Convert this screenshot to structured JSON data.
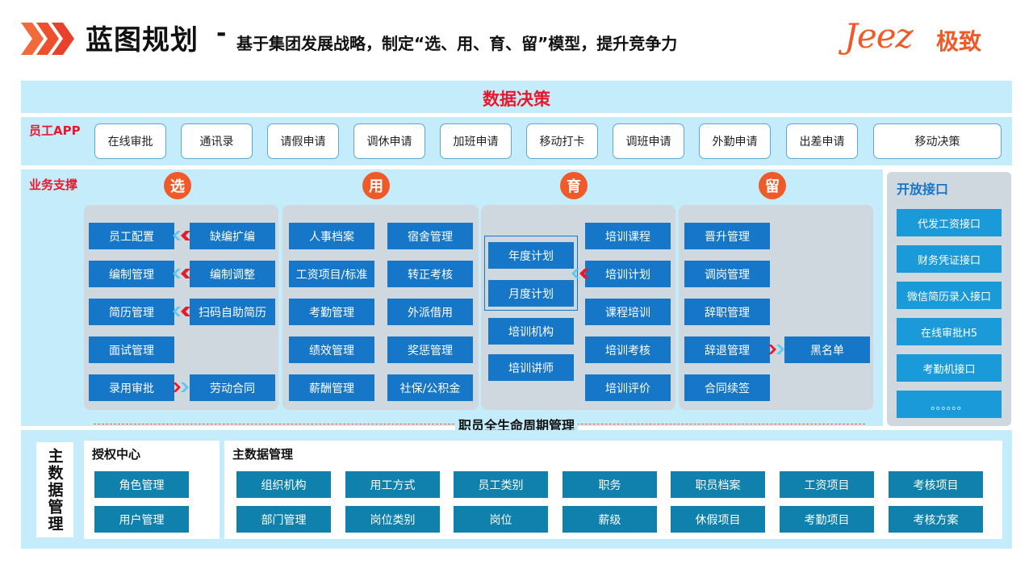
{
  "header": {
    "title": "蓝图规划",
    "dash": "-",
    "subtitle": "基于集团发展战略，制定“选、用、育、留”模型，提升竞争力",
    "logo_latin": "Jeez",
    "logo_cn": "极致",
    "colors": {
      "accent": "#f05a28",
      "chevron": "#e8402a"
    }
  },
  "decision": {
    "title": "数据决策"
  },
  "employee_app": {
    "label": "员工APP",
    "items": [
      "在线审批",
      "通讯录",
      "请假申请",
      "调休申请",
      "加班申请",
      "移动打卡",
      "调班申请",
      "外勤申请",
      "出差申请",
      "移动决策"
    ]
  },
  "business": {
    "label": "业务支撑",
    "select": {
      "badge": "选",
      "left": [
        "员工配置",
        "编制管理",
        "简历管理",
        "面试管理",
        "录用审批"
      ],
      "right": [
        "缺编扩编",
        "编制调整",
        "扫码自助简历",
        "劳动合同"
      ]
    },
    "use": {
      "badge": "用",
      "left": [
        "人事档案",
        "工资项目/标准",
        "考勤管理",
        "绩效管理",
        "薪酬管理"
      ],
      "right": [
        "宿舍管理",
        "转正考核",
        "外派借用",
        "奖惩管理",
        "社保/公积金"
      ]
    },
    "develop": {
      "badge": "育",
      "left": [
        "年度计划",
        "月度计划",
        "培训机构",
        "培训讲师"
      ],
      "right": [
        "培训课程",
        "培训计划",
        "课程培训",
        "培训考核",
        "培训评价"
      ]
    },
    "retain": {
      "badge": "留",
      "left": [
        "晋升管理",
        "调岗管理",
        "辞职管理",
        "辞退管理",
        "合同续签"
      ],
      "right": [
        "黑名单"
      ]
    },
    "colors": {
      "box": "#1676c8",
      "badge": "#f05a28",
      "panel": "#cfd8de"
    }
  },
  "lifecycle": {
    "label": "职员全生命周期管理"
  },
  "open_api": {
    "title": "开放接口",
    "items": [
      "代发工资接口",
      "财务凭证接口",
      "微信简历录入接口",
      "在线审批H5",
      "考勤机接口",
      "。。。。。。"
    ]
  },
  "master": {
    "vertical_label": "主数据管理",
    "auth": {
      "title": "授权中心",
      "items": [
        "角色管理",
        "用户管理"
      ]
    },
    "data": {
      "title": "主数据管理",
      "row1": [
        "组织机构",
        "用工方式",
        "员工类别",
        "职务",
        "职员档案",
        "工资项目",
        "考核项目"
      ],
      "row2": [
        "部门管理",
        "岗位类别",
        "岗位",
        "薪级",
        "休假项目",
        "考勤项目",
        "考核方案"
      ]
    }
  }
}
